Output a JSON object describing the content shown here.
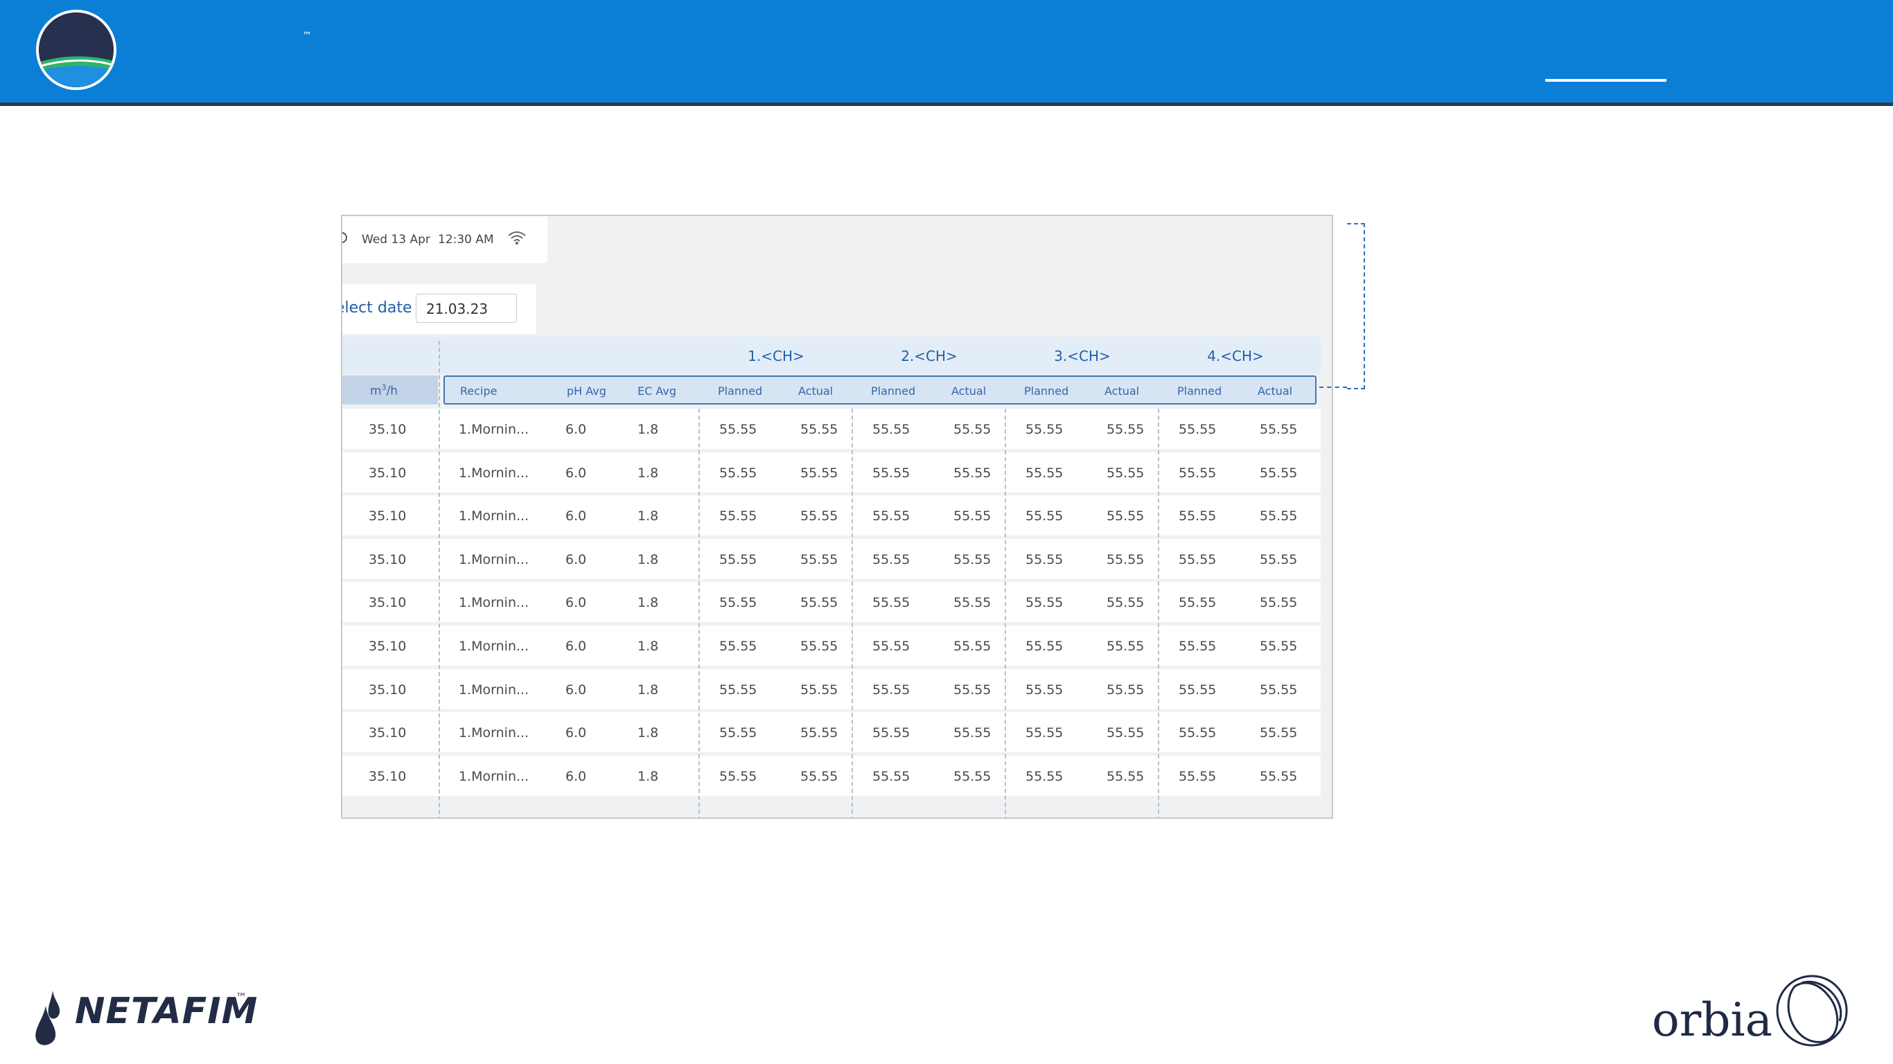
{
  "header": {
    "tm": "™"
  },
  "status_bar": {
    "date": "Wed 13 Apr",
    "time": "12:30 AM"
  },
  "date_picker": {
    "label": "elect date",
    "value": "21.03.23"
  },
  "channels": [
    "1.<CH>",
    "2.<CH>",
    "3.<CH>",
    "4.<CH>"
  ],
  "columns": {
    "flow": "m3/h",
    "recipe": "Recipe",
    "ph_avg": "pH Avg",
    "ec_avg": "EC Avg",
    "planned": "Planned",
    "actual": "Actual"
  },
  "rows": [
    {
      "flow": "35.10",
      "recipe": "1.Mornin...",
      "ph": "6.0",
      "ec": "1.8",
      "c1p": "55.55",
      "c1a": "55.55",
      "c2p": "55.55",
      "c2a": "55.55",
      "c3p": "55.55",
      "c3a": "55.55",
      "c4p": "55.55",
      "c4a": "55.55"
    },
    {
      "flow": "35.10",
      "recipe": "1.Mornin...",
      "ph": "6.0",
      "ec": "1.8",
      "c1p": "55.55",
      "c1a": "55.55",
      "c2p": "55.55",
      "c2a": "55.55",
      "c3p": "55.55",
      "c3a": "55.55",
      "c4p": "55.55",
      "c4a": "55.55"
    },
    {
      "flow": "35.10",
      "recipe": "1.Mornin...",
      "ph": "6.0",
      "ec": "1.8",
      "c1p": "55.55",
      "c1a": "55.55",
      "c2p": "55.55",
      "c2a": "55.55",
      "c3p": "55.55",
      "c3a": "55.55",
      "c4p": "55.55",
      "c4a": "55.55"
    },
    {
      "flow": "35.10",
      "recipe": "1.Mornin...",
      "ph": "6.0",
      "ec": "1.8",
      "c1p": "55.55",
      "c1a": "55.55",
      "c2p": "55.55",
      "c2a": "55.55",
      "c3p": "55.55",
      "c3a": "55.55",
      "c4p": "55.55",
      "c4a": "55.55"
    },
    {
      "flow": "35.10",
      "recipe": "1.Mornin...",
      "ph": "6.0",
      "ec": "1.8",
      "c1p": "55.55",
      "c1a": "55.55",
      "c2p": "55.55",
      "c2a": "55.55",
      "c3p": "55.55",
      "c3a": "55.55",
      "c4p": "55.55",
      "c4a": "55.55"
    },
    {
      "flow": "35.10",
      "recipe": "1.Mornin...",
      "ph": "6.0",
      "ec": "1.8",
      "c1p": "55.55",
      "c1a": "55.55",
      "c2p": "55.55",
      "c2a": "55.55",
      "c3p": "55.55",
      "c3a": "55.55",
      "c4p": "55.55",
      "c4a": "55.55"
    },
    {
      "flow": "35.10",
      "recipe": "1.Mornin...",
      "ph": "6.0",
      "ec": "1.8",
      "c1p": "55.55",
      "c1a": "55.55",
      "c2p": "55.55",
      "c2a": "55.55",
      "c3p": "55.55",
      "c3a": "55.55",
      "c4p": "55.55",
      "c4a": "55.55"
    },
    {
      "flow": "35.10",
      "recipe": "1.Mornin...",
      "ph": "6.0",
      "ec": "1.8",
      "c1p": "55.55",
      "c1a": "55.55",
      "c2p": "55.55",
      "c2a": "55.55",
      "c3p": "55.55",
      "c3a": "55.55",
      "c4p": "55.55",
      "c4a": "55.55"
    },
    {
      "flow": "35.10",
      "recipe": "1.Mornin...",
      "ph": "6.0",
      "ec": "1.8",
      "c1p": "55.55",
      "c1a": "55.55",
      "c2p": "55.55",
      "c2a": "55.55",
      "c3p": "55.55",
      "c3a": "55.55",
      "c4p": "55.55",
      "c4a": "55.55"
    }
  ],
  "footer": {
    "netafim": "NETAFIM",
    "netafim_tm": "™",
    "orbia": "orbia"
  },
  "colors": {
    "header_blue": "#0b7fd6",
    "accent_blue": "#1f5fa8",
    "header_row_bg": "#d6e4f4"
  }
}
